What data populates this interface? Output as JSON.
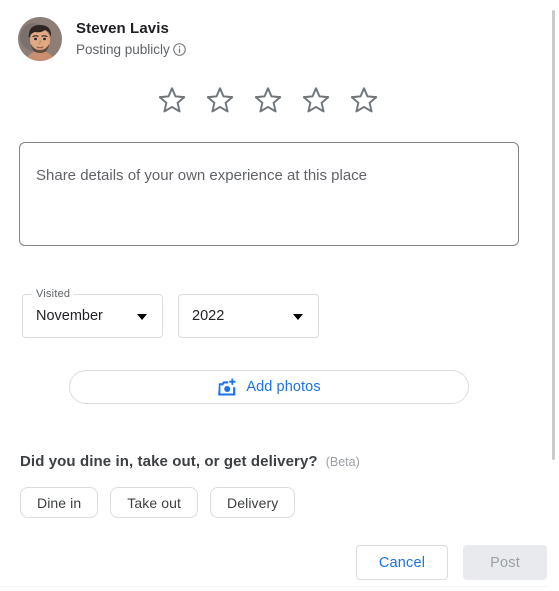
{
  "author": {
    "name": "Steven Lavis",
    "visibility": "Posting publicly",
    "info_icon": "info-icon",
    "avatar_alt": "avatar"
  },
  "rating": {
    "value": 0,
    "max": 5,
    "star_icon": "star-outline-icon",
    "stars": [
      {
        "index": 1,
        "filled": false
      },
      {
        "index": 2,
        "filled": false
      },
      {
        "index": 3,
        "filled": false
      },
      {
        "index": 4,
        "filled": false
      },
      {
        "index": 5,
        "filled": false
      }
    ]
  },
  "review": {
    "value": "",
    "placeholder": "Share details of your own experience at this place"
  },
  "visited": {
    "legend": "Visited",
    "month": {
      "selected": "November",
      "arrow_icon": "chevron-down-icon"
    },
    "year": {
      "selected": "2022",
      "arrow_icon": "chevron-down-icon"
    }
  },
  "add_photos": {
    "label": "Add photos",
    "icon": "camera-plus-icon"
  },
  "dine": {
    "question": "Did you dine in, take out, or get delivery?",
    "beta": "(Beta)",
    "options": [
      {
        "label": "Dine in",
        "selected": false
      },
      {
        "label": "Take out",
        "selected": false
      },
      {
        "label": "Delivery",
        "selected": false
      }
    ]
  },
  "footer": {
    "cancel_label": "Cancel",
    "post_label": "Post",
    "post_disabled": true
  },
  "colors": {
    "accent_blue": "#1a73e8",
    "text_primary": "#202124",
    "text_secondary": "#5f6368",
    "text_muted": "#9aa0a6",
    "border": "#dadce0",
    "border_strong": "#80868b",
    "disabled_bg": "#e8eaed",
    "star_outline": "#70757a",
    "scrollbar_thumb": "#c7c9cc"
  }
}
